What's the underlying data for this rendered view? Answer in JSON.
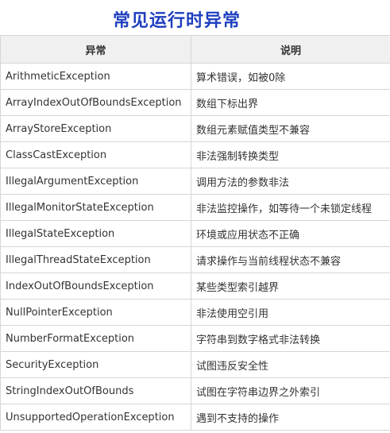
{
  "title": "常见运行时异常",
  "table": {
    "headers": [
      "异常",
      "说明"
    ],
    "rows": [
      [
        "ArithmeticException",
        "算术错误，如被0除"
      ],
      [
        "ArrayIndexOutOfBoundsException",
        "数组下标出界"
      ],
      [
        "ArrayStoreException",
        "数组元素赋值类型不兼容"
      ],
      [
        "ClassCastException",
        "非法强制转换类型"
      ],
      [
        "IllegalArgumentException",
        "调用方法的参数非法"
      ],
      [
        "IllegalMonitorStateException",
        "非法监控操作，如等待一个未锁定线程"
      ],
      [
        "IllegalStateException",
        "环境或应用状态不正确"
      ],
      [
        "IllegalThreadStateException",
        "请求操作与当前线程状态不兼容"
      ],
      [
        "IndexOutOfBoundsException",
        "某些类型索引越界"
      ],
      [
        "NullPointerException",
        "非法使用空引用"
      ],
      [
        "NumberFormatException",
        "字符串到数字格式非法转换"
      ],
      [
        "SecurityException",
        "试图违反安全性"
      ],
      [
        "StringIndexOutOfBounds",
        "试图在字符串边界之外索引"
      ],
      [
        "UnsupportedOperationException",
        "遇到不支持的操作"
      ]
    ]
  }
}
